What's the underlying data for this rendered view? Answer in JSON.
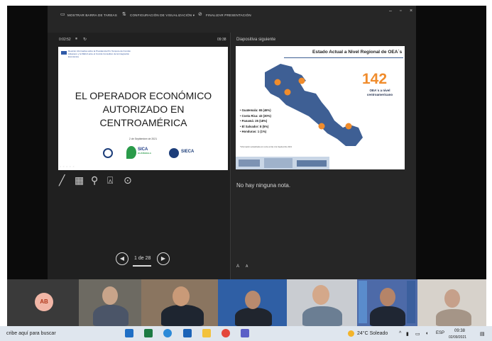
{
  "toolbar": {
    "taskbar_toggle": "MOSTRAR BARRA DE TAREAS",
    "display_settings": "CONFIGURACIÓN DE VISUALIZACIÓN ▾",
    "end_show": "FINALIZAR PRESENTACIÓN",
    "window_controls": [
      "–",
      "▫",
      "×"
    ]
  },
  "presenter": {
    "timer": "0:02:52",
    "clock": "09:38",
    "next_slide_label": "Diapositiva siguiente",
    "notes": "No hay ninguna nota.",
    "page_indicator": "1 de 28",
    "text_size_controls": [
      "A",
      "A"
    ]
  },
  "current_slide": {
    "note_text": "Reunión informativa sobre la Presidencia Pro Tempore del Comité Aduanero y la SIECA ante el Comité Consultivo de la Integración Económica",
    "title_lines": [
      "EL OPERADOR ECONÓMICO",
      "AUTORIZADO EN",
      "CENTROAMÉRICA"
    ],
    "date": "2 de Septiembre de 2021",
    "logo_sica": "SICA",
    "logo_sica_sub": "GUATEMALA",
    "logo_sieca": "SIECA"
  },
  "next_slide": {
    "title": "Estado Actual a Nivel Regional de OEA´s",
    "big_number": "142",
    "big_caption_lines": [
      "OEA´s a nivel",
      "centroamericano"
    ],
    "bullets": [
      "Guatemala: 65 (46%)",
      "Costa Rica: 43 (30%)",
      "Panamá: 25 (18%)",
      "El Salvador: 8 (5%)",
      "Honduras: 1 (1%)"
    ],
    "footnote": "*Información actualizada con corte al día 1 de Septiembre 2021"
  },
  "participants": {
    "self_initials": "AB"
  },
  "taskbar": {
    "search_text": "cribe aquí para buscar",
    "weather": "24°C  Soleado",
    "language": "ESP",
    "time": "09:38",
    "date": "02/09/2021"
  },
  "colors": {
    "accent_orange": "#f08c2c",
    "map_blue": "#3e5f94",
    "avatar_bg": "#f1b6a6"
  }
}
